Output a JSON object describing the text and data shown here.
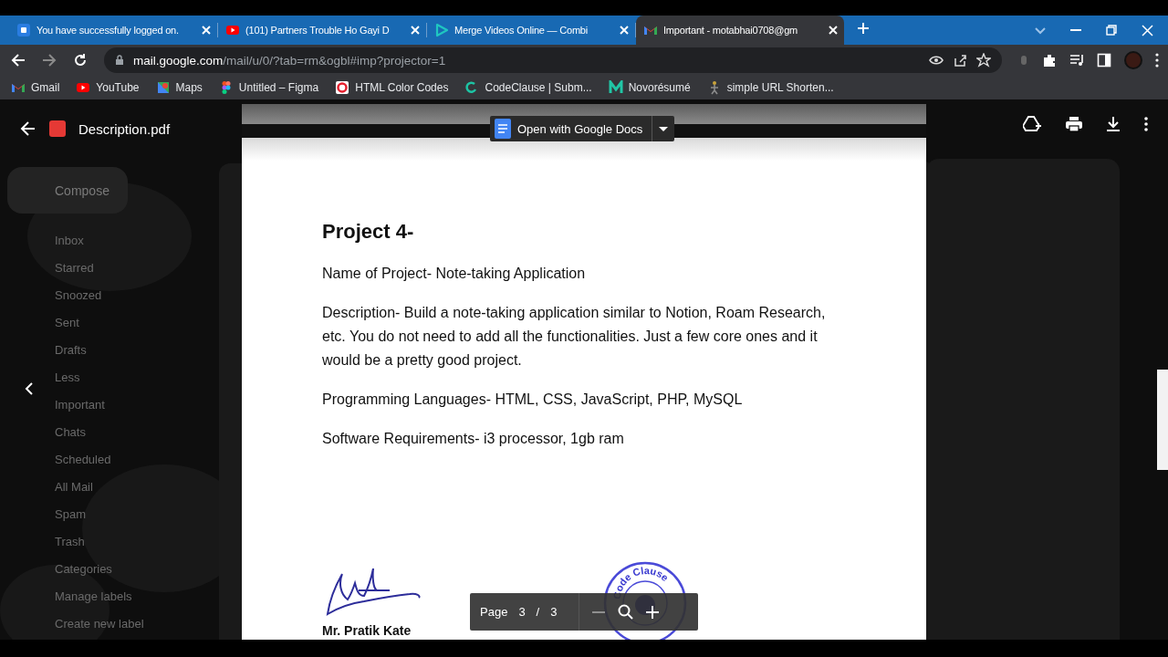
{
  "tabs": [
    {
      "title": "You have successfully logged on.",
      "kind": "square",
      "selected": false
    },
    {
      "title": "(101) Partners Trouble Ho Gayi D",
      "kind": "youtube",
      "selected": false
    },
    {
      "title": "Merge Videos Online — Combi",
      "kind": "play",
      "selected": false
    },
    {
      "title": "Important - motabhai0708@gm",
      "kind": "gmail",
      "selected": true
    }
  ],
  "address": {
    "host": "mail.google.com",
    "path": "/mail/u/0/?tab=rm&ogbl#imp?projector=1"
  },
  "bookmarks": [
    {
      "label": "Gmail",
      "kind": "gmail"
    },
    {
      "label": "YouTube",
      "kind": "youtube"
    },
    {
      "label": "Maps",
      "kind": "maps"
    },
    {
      "label": "Untitled – Figma",
      "kind": "figma"
    },
    {
      "label": "HTML Color Codes",
      "kind": "ring"
    },
    {
      "label": "CodeClause | Subm...",
      "kind": "hook"
    },
    {
      "label": "Novorésumé",
      "kind": "novo"
    },
    {
      "label": "simple URL Shorten...",
      "kind": "figure"
    }
  ],
  "gmail_background": {
    "compose": "Compose",
    "labels": [
      "Inbox",
      "Starred",
      "Snoozed",
      "Sent",
      "Drafts",
      "Less",
      "Important",
      "Chats",
      "Scheduled",
      "All Mail",
      "Spam",
      "Trash",
      "Categories",
      "Manage labels",
      "Create new label"
    ]
  },
  "viewer": {
    "file_name": "Description.pdf",
    "open_with": "Open with Google Docs"
  },
  "document": {
    "heading": "Project 4-",
    "paragraphs": [
      "Name of Project- Note-taking Application",
      "Description- Build a note-taking application similar to Notion, Roam Research, etc. You do not need to add all the functionalities. Just a few core ones and it would be a pretty good project.",
      "Programming Languages- HTML, CSS, JavaScript, PHP, MySQL",
      "Software Requirements- i3 processor, 1gb ram"
    ],
    "stamp_text": "Code Clause",
    "signatory": "Mr. Pratik Kate"
  },
  "page_controls": {
    "label": "Page",
    "current": "3",
    "separator": "/",
    "total": "3"
  }
}
